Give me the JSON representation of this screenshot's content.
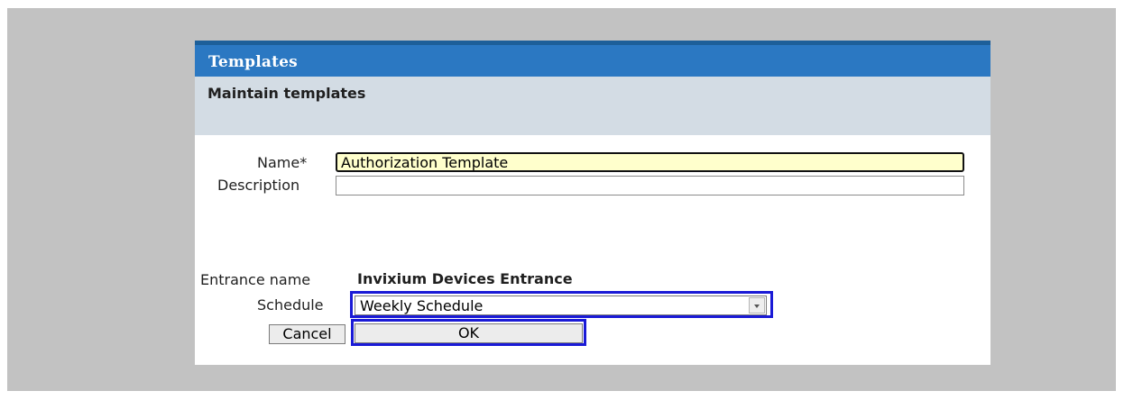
{
  "dialog": {
    "title": "Templates",
    "subtitle": "Maintain templates"
  },
  "form": {
    "name_label": "Name*",
    "name_value": "Authorization Template",
    "description_label": "Description",
    "description_value": "",
    "entrance_label": "Entrance name",
    "entrance_value": "Invixium Devices Entrance",
    "schedule_label": "Schedule",
    "schedule_value": "Weekly Schedule"
  },
  "buttons": {
    "cancel_label": "Cancel",
    "ok_label": "OK"
  },
  "icons": {
    "schedule_dropdown": "chevron-down-icon"
  },
  "colors": {
    "titlebar": "#2b78c2",
    "subheader": "#d3dce4",
    "name_field_bg": "#ffffcc",
    "highlight_outline": "#1a1ad6",
    "backdrop": "#c2c2c2"
  }
}
